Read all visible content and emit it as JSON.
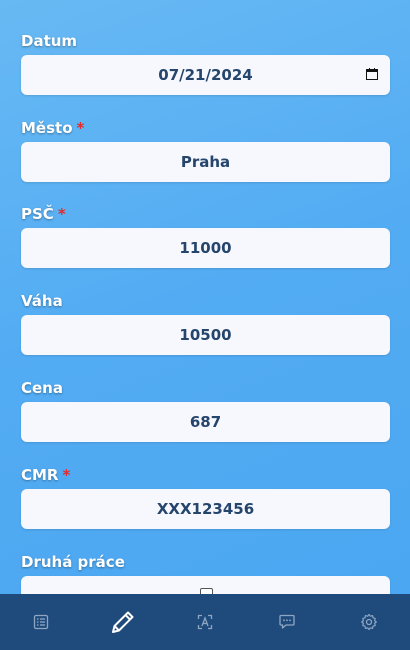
{
  "form": {
    "date": {
      "label": "Datum",
      "value": "07/21/2024"
    },
    "city": {
      "label": "Město",
      "required_mark": "*",
      "value": "Praha"
    },
    "zip": {
      "label": "PSČ",
      "required_mark": "*",
      "value": "11000"
    },
    "weight": {
      "label": "Váha",
      "value": "10500"
    },
    "price": {
      "label": "Cena",
      "value": "687"
    },
    "cmr": {
      "label": "CMR",
      "required_mark": "*",
      "value": "XXX123456"
    },
    "second_job": {
      "label": "Druhá práce",
      "checked": false
    }
  },
  "nav": {
    "items": [
      {
        "icon": "list-icon",
        "active": false
      },
      {
        "icon": "pencil-icon",
        "active": true
      },
      {
        "icon": "scan-text-icon",
        "active": false
      },
      {
        "icon": "chat-icon",
        "active": false
      },
      {
        "icon": "gear-icon",
        "active": false
      }
    ]
  },
  "colors": {
    "background": "#5aaff3",
    "navbar": "#1f4a7c",
    "input_text": "#25456d",
    "required": "#e32b2b",
    "nav_icon_inactive": "#8fa6c2",
    "nav_icon_active": "#ffffff"
  }
}
